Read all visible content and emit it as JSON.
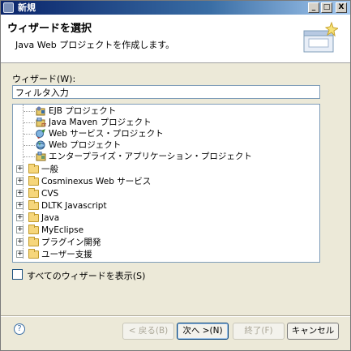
{
  "window": {
    "title": "新規",
    "controls": {
      "minimize": "_",
      "maximize": "□",
      "close": "X"
    }
  },
  "banner": {
    "title": "ウィザードを選択",
    "description": "Java Web プロジェクトを作成します。",
    "graphic": "wizard-banner-icon"
  },
  "wizard_label": "ウィザード(W):",
  "filter": {
    "value": "フィルタ入力"
  },
  "tree": {
    "items": [
      {
        "label": "EJB プロジェクト",
        "icon": "ejb-project-icon",
        "level": 1,
        "expander": ""
      },
      {
        "label": "Java Maven プロジェクト",
        "icon": "maven-project-icon",
        "level": 1,
        "expander": ""
      },
      {
        "label": "Web サービス・プロジェクト",
        "icon": "web-service-project-icon",
        "level": 1,
        "expander": ""
      },
      {
        "label": "Web プロジェクト",
        "icon": "web-project-icon",
        "level": 1,
        "expander": ""
      },
      {
        "label": "エンタープライズ・アプリケーション・プロジェクト",
        "icon": "enterprise-app-project-icon",
        "level": 1,
        "expander": ""
      },
      {
        "label": "一般",
        "icon": "folder-icon",
        "level": 0,
        "expander": "+"
      },
      {
        "label": "Cosminexus Web サービス",
        "icon": "folder-icon",
        "level": 0,
        "expander": "+"
      },
      {
        "label": "CVS",
        "icon": "folder-icon",
        "level": 0,
        "expander": "+"
      },
      {
        "label": "DLTK Javascript",
        "icon": "folder-icon",
        "level": 0,
        "expander": "+"
      },
      {
        "label": "Java",
        "icon": "folder-icon",
        "level": 0,
        "expander": "+"
      },
      {
        "label": "MyEclipse",
        "icon": "folder-icon",
        "level": 0,
        "expander": "+"
      },
      {
        "label": "プラグイン開発",
        "icon": "folder-icon",
        "level": 0,
        "expander": "+"
      },
      {
        "label": "ユーザー支援",
        "icon": "folder-icon",
        "level": 0,
        "expander": "+"
      }
    ]
  },
  "show_all": {
    "label": "すべてのウィザードを表示(S)",
    "checked": false
  },
  "buttons": {
    "help": "?",
    "back": "< 戻る(B)",
    "next": "次へ >(N)",
    "finish": "終了(F)",
    "cancel": "キャンセル"
  },
  "colors": {
    "titlebar_start": "#0a246a",
    "dialog_bg": "#ece9d8",
    "folder": "#f6d67b",
    "disabled_text": "#aca899"
  }
}
